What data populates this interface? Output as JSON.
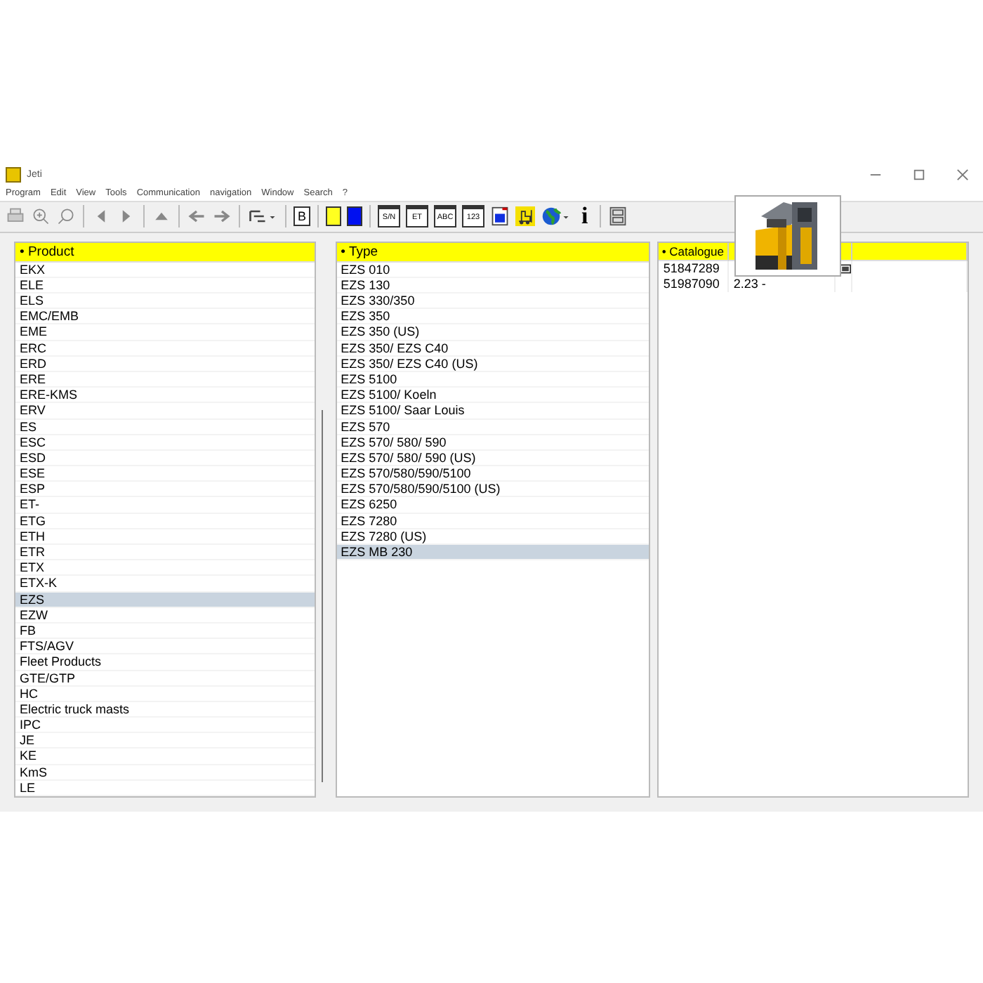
{
  "window": {
    "title": "Jeti"
  },
  "menu": [
    "Program",
    "Edit",
    "View",
    "Tools",
    "Communication",
    "navigation",
    "Window",
    "Search",
    "?"
  ],
  "toolbar": [
    {
      "kind": "print"
    },
    {
      "kind": "zoom-in"
    },
    {
      "kind": "search"
    },
    {
      "kind": "sep"
    },
    {
      "kind": "left"
    },
    {
      "kind": "right"
    },
    {
      "kind": "sep"
    },
    {
      "kind": "up"
    },
    {
      "kind": "sep"
    },
    {
      "kind": "back"
    },
    {
      "kind": "forward"
    },
    {
      "kind": "sep"
    },
    {
      "kind": "tree"
    },
    {
      "kind": "sep"
    },
    {
      "kind": "doc",
      "label": "B"
    },
    {
      "kind": "sep"
    },
    {
      "kind": "yellow"
    },
    {
      "kind": "blue"
    },
    {
      "kind": "sep"
    },
    {
      "kind": "card",
      "label": "S/N"
    },
    {
      "kind": "card",
      "label": "ET"
    },
    {
      "kind": "card",
      "label": "ABC"
    },
    {
      "kind": "card",
      "label": "123"
    },
    {
      "kind": "bluecard"
    },
    {
      "kind": "truck"
    },
    {
      "kind": "globe"
    },
    {
      "kind": "info",
      "label": "i"
    },
    {
      "kind": "sep"
    },
    {
      "kind": "cabinet"
    }
  ],
  "products": {
    "header": "• Product",
    "rows": [
      {
        "text": "EKX",
        "selected": false
      },
      {
        "text": "ELE",
        "selected": false
      },
      {
        "text": "ELS",
        "selected": false
      },
      {
        "text": "EMC/EMB",
        "selected": false
      },
      {
        "text": "EME",
        "selected": false
      },
      {
        "text": "ERC",
        "selected": false
      },
      {
        "text": "ERD",
        "selected": false
      },
      {
        "text": "ERE",
        "selected": false
      },
      {
        "text": "ERE-KMS",
        "selected": false
      },
      {
        "text": "ERV",
        "selected": false
      },
      {
        "text": "ES",
        "selected": false
      },
      {
        "text": "ESC",
        "selected": false
      },
      {
        "text": "ESD",
        "selected": false
      },
      {
        "text": "ESE",
        "selected": false
      },
      {
        "text": "ESP",
        "selected": false
      },
      {
        "text": "ET-",
        "selected": false
      },
      {
        "text": "ETG",
        "selected": false
      },
      {
        "text": "ETH",
        "selected": false
      },
      {
        "text": "ETR",
        "selected": false
      },
      {
        "text": "ETX",
        "selected": false
      },
      {
        "text": "ETX-K",
        "selected": false
      },
      {
        "text": "EZS",
        "selected": true
      },
      {
        "text": "EZW",
        "selected": false
      },
      {
        "text": "FB",
        "selected": false
      },
      {
        "text": "FTS/AGV",
        "selected": false
      },
      {
        "text": "Fleet Products",
        "selected": false
      },
      {
        "text": "GTE/GTP",
        "selected": false
      },
      {
        "text": "HC",
        "selected": false
      },
      {
        "text": "Electric truck masts",
        "selected": false
      },
      {
        "text": "IPC",
        "selected": false
      },
      {
        "text": "JE",
        "selected": false
      },
      {
        "text": "KE",
        "selected": false
      },
      {
        "text": "KmS",
        "selected": false
      },
      {
        "text": "LE",
        "selected": false
      }
    ]
  },
  "types": {
    "header": "• Type",
    "rows": [
      {
        "text": "EZS 010",
        "selected": false
      },
      {
        "text": "EZS 130",
        "selected": false
      },
      {
        "text": "EZS 330/350",
        "selected": false
      },
      {
        "text": "EZS 350",
        "selected": false
      },
      {
        "text": "EZS 350 (US)",
        "selected": false
      },
      {
        "text": "EZS 350/ EZS C40",
        "selected": false
      },
      {
        "text": "EZS 350/ EZS C40 (US)",
        "selected": false
      },
      {
        "text": "EZS 5100",
        "selected": false
      },
      {
        "text": "EZS 5100/ Koeln",
        "selected": false
      },
      {
        "text": "EZS 5100/ Saar Louis",
        "selected": false
      },
      {
        "text": "EZS 570",
        "selected": false
      },
      {
        "text": "EZS 570/ 580/ 590",
        "selected": false
      },
      {
        "text": "EZS 570/ 580/ 590 (US)",
        "selected": false
      },
      {
        "text": "EZS 570/580/590/5100",
        "selected": false
      },
      {
        "text": "EZS 570/580/590/5100 (US)",
        "selected": false
      },
      {
        "text": "EZS 6250",
        "selected": false
      },
      {
        "text": "EZS 7280",
        "selected": false
      },
      {
        "text": "EZS 7280 (US)",
        "selected": false
      },
      {
        "text": "EZS MB 230",
        "selected": true
      }
    ]
  },
  "catalogue": {
    "header": "• Catalogue",
    "rows": [
      {
        "number": "51847289",
        "has_icon": true
      },
      {
        "number": "51987090",
        "version": "2.23 -",
        "has_icon": false
      }
    ]
  }
}
